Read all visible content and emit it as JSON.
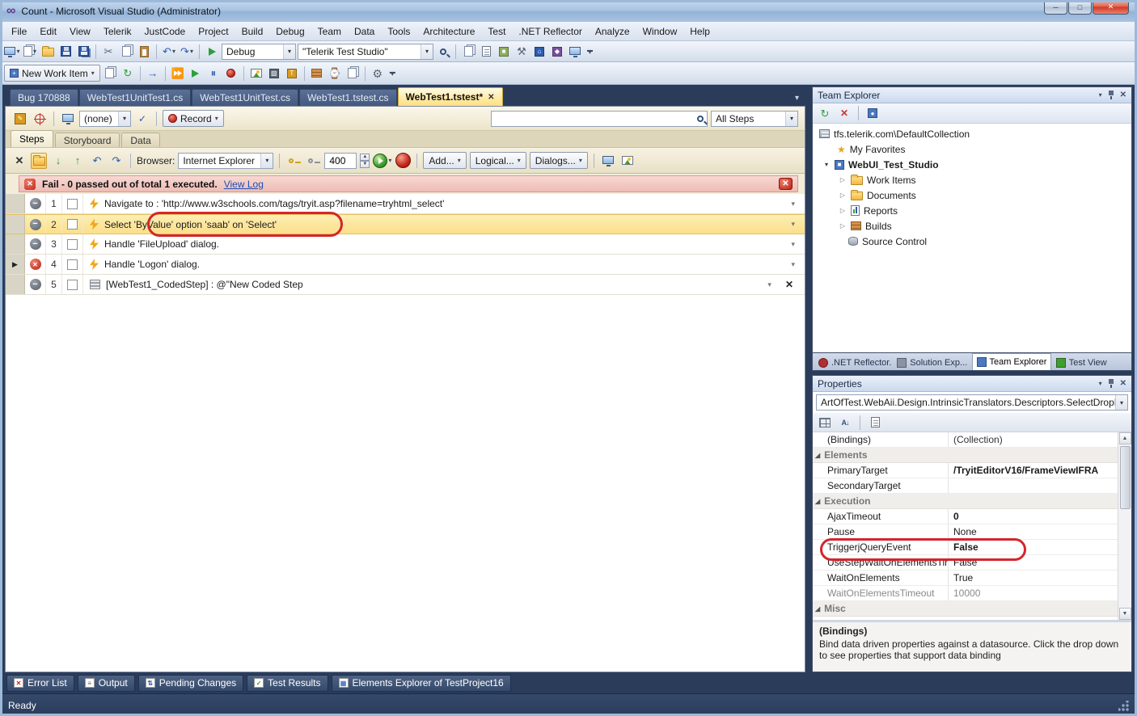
{
  "window": {
    "title": "Count - Microsoft Visual Studio (Administrator)"
  },
  "menubar": {
    "items": [
      "File",
      "Edit",
      "View",
      "Telerik",
      "JustCode",
      "Project",
      "Build",
      "Debug",
      "Team",
      "Data",
      "Tools",
      "Architecture",
      "Test",
      ".NET Reflector",
      "Analyze",
      "Window",
      "Help"
    ]
  },
  "toolbar1": {
    "debug_value": "Debug",
    "config_value": "\"Telerik Test Studio\""
  },
  "toolbar2": {
    "new_work_item_label": "New Work Item"
  },
  "doc_tabs": {
    "tabs": [
      {
        "label": "Bug 170888"
      },
      {
        "label": "WebTest1UnitTest1.cs"
      },
      {
        "label": "WebTest1UnitTest.cs"
      },
      {
        "label": "WebTest1.tstest.cs"
      },
      {
        "label": "WebTest1.tstest*"
      }
    ]
  },
  "ribbon": {
    "none_value": "(none)",
    "record_label": "Record",
    "all_steps_value": "All Steps"
  },
  "view_tabs": {
    "steps": "Steps",
    "storyboard": "Storyboard",
    "data": "Data"
  },
  "steps_toolbar": {
    "browser_label": "Browser:",
    "browser_value": "Internet Explorer",
    "speed_value": "400",
    "add_label": "Add...",
    "logical_label": "Logical...",
    "dialogs_label": "Dialogs..."
  },
  "fail_bar": {
    "message": "Fail - 0 passed out of total 1 executed.",
    "link_label": "View Log"
  },
  "steps": {
    "rows": [
      {
        "num": "1",
        "text": "Navigate to : 'http://www.w3schools.com/tags/tryit.asp?filename=tryhtml_select'"
      },
      {
        "num": "2",
        "text": "Select 'ByValue' option 'saab' on 'Select'"
      },
      {
        "num": "3",
        "text": "Handle 'FileUpload' dialog."
      },
      {
        "num": "4",
        "text": "Handle 'Logon' dialog."
      },
      {
        "num": "5",
        "text": "[WebTest1_CodedStep] : @\"New Coded Step"
      }
    ]
  },
  "team_explorer": {
    "title": "Team Explorer",
    "tree": [
      {
        "label": "tfs.telerik.com\\DefaultCollection"
      },
      {
        "label": "My Favorites"
      },
      {
        "label": "WebUI_Test_Studio"
      },
      {
        "label": "Work Items"
      },
      {
        "label": "Documents"
      },
      {
        "label": "Reports"
      },
      {
        "label": "Builds"
      },
      {
        "label": "Source Control"
      }
    ]
  },
  "panel_tabs": {
    "tabs": [
      {
        "label": ".NET Reflector..."
      },
      {
        "label": "Solution Exp..."
      },
      {
        "label": "Team Explorer"
      },
      {
        "label": "Test View"
      }
    ]
  },
  "properties": {
    "title": "Properties",
    "object_value": "ArtOfTest.WebAii.Design.IntrinsicTranslators.Descriptors.SelectDropDo",
    "rows": [
      {
        "name": "(Bindings)",
        "value": "(Collection)"
      },
      {
        "name": "Elements"
      },
      {
        "name": "PrimaryTarget",
        "value": "/TryitEditorV16/FrameViewIFRA"
      },
      {
        "name": "SecondaryTarget",
        "value": ""
      },
      {
        "name": "Execution"
      },
      {
        "name": "AjaxTimeout",
        "value": "0"
      },
      {
        "name": "Pause",
        "value": "None"
      },
      {
        "name": "TriggerjQueryEvent",
        "value": "False"
      },
      {
        "name": "UseStepWaitOnElementsTimeo",
        "value": "False"
      },
      {
        "name": "WaitOnElements",
        "value": "True"
      },
      {
        "name": "WaitOnElementsTimeout",
        "value": "10000"
      },
      {
        "name": "Misc"
      }
    ],
    "description": {
      "title": "(Bindings)",
      "text": "Bind data driven properties against a datasource. Click the drop down to see properties that support data binding"
    }
  },
  "bottom_bar": {
    "items": [
      "Error List",
      "Output",
      "Pending Changes",
      "Test Results",
      "Elements Explorer of TestProject16"
    ]
  },
  "status_bar": {
    "text": "Ready"
  },
  "icons": {
    "search-icon": "lens css-shape",
    "record-icon": "red-circle css-shape",
    "lightning-icon": "orange bolt clip-path",
    "disable-step-icon": "− in gray circle",
    "error-step-icon": "✕ in red circle",
    "dropdown-icon": "▾",
    "close-icon": "✕",
    "undo-icon": "↶",
    "redo-icon": "↷",
    "refresh-icon": "↻",
    "gear-icon": "⚙",
    "star-icon": "★"
  },
  "colors": {
    "active_tab": "#ffe9a2",
    "fail_bar": "#f2cdc6",
    "selected_step": "#fbdf8a",
    "annotation": "#d3262c",
    "frame_blue": "#2b3c5b"
  }
}
